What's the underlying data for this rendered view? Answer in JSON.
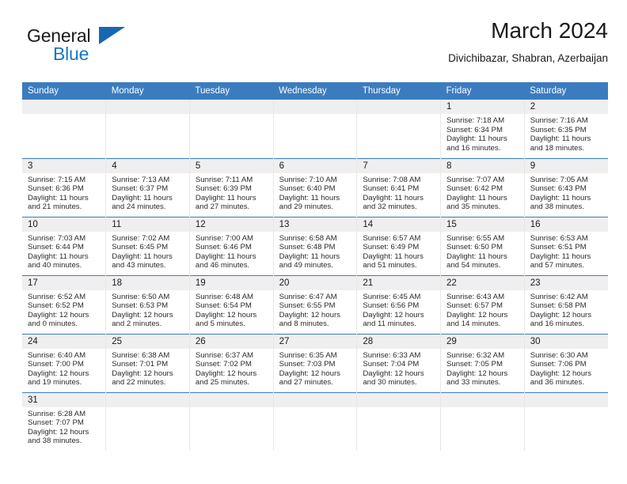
{
  "brand": {
    "line1": "General",
    "line2": "Blue",
    "flag_icon": "blue-triangle-flag"
  },
  "header": {
    "title": "March 2024",
    "subtitle": "Divichibazar, Shabran, Azerbaijan"
  },
  "colors": {
    "header_blue": "#3b7cc0",
    "brand_blue": "#1877c4",
    "daynum_band": "#efefef",
    "divider": "#e8e8e8"
  },
  "weekday_headers": [
    "Sunday",
    "Monday",
    "Tuesday",
    "Wednesday",
    "Thursday",
    "Friday",
    "Saturday"
  ],
  "labels": {
    "sunrise_prefix": "Sunrise: ",
    "sunset_prefix": "Sunset: ",
    "daylight_prefix": "Daylight: "
  },
  "weeks": [
    [
      {
        "day": "",
        "empty": true
      },
      {
        "day": "",
        "empty": true
      },
      {
        "day": "",
        "empty": true
      },
      {
        "day": "",
        "empty": true
      },
      {
        "day": "",
        "empty": true
      },
      {
        "day": "1",
        "sunrise": "Sunrise: 7:18 AM",
        "sunset": "Sunset: 6:34 PM",
        "daylight_l1": "Daylight: 11 hours",
        "daylight_l2": "and 16 minutes."
      },
      {
        "day": "2",
        "sunrise": "Sunrise: 7:16 AM",
        "sunset": "Sunset: 6:35 PM",
        "daylight_l1": "Daylight: 11 hours",
        "daylight_l2": "and 18 minutes."
      }
    ],
    [
      {
        "day": "3",
        "sunrise": "Sunrise: 7:15 AM",
        "sunset": "Sunset: 6:36 PM",
        "daylight_l1": "Daylight: 11 hours",
        "daylight_l2": "and 21 minutes."
      },
      {
        "day": "4",
        "sunrise": "Sunrise: 7:13 AM",
        "sunset": "Sunset: 6:37 PM",
        "daylight_l1": "Daylight: 11 hours",
        "daylight_l2": "and 24 minutes."
      },
      {
        "day": "5",
        "sunrise": "Sunrise: 7:11 AM",
        "sunset": "Sunset: 6:39 PM",
        "daylight_l1": "Daylight: 11 hours",
        "daylight_l2": "and 27 minutes."
      },
      {
        "day": "6",
        "sunrise": "Sunrise: 7:10 AM",
        "sunset": "Sunset: 6:40 PM",
        "daylight_l1": "Daylight: 11 hours",
        "daylight_l2": "and 29 minutes."
      },
      {
        "day": "7",
        "sunrise": "Sunrise: 7:08 AM",
        "sunset": "Sunset: 6:41 PM",
        "daylight_l1": "Daylight: 11 hours",
        "daylight_l2": "and 32 minutes."
      },
      {
        "day": "8",
        "sunrise": "Sunrise: 7:07 AM",
        "sunset": "Sunset: 6:42 PM",
        "daylight_l1": "Daylight: 11 hours",
        "daylight_l2": "and 35 minutes."
      },
      {
        "day": "9",
        "sunrise": "Sunrise: 7:05 AM",
        "sunset": "Sunset: 6:43 PM",
        "daylight_l1": "Daylight: 11 hours",
        "daylight_l2": "and 38 minutes."
      }
    ],
    [
      {
        "day": "10",
        "sunrise": "Sunrise: 7:03 AM",
        "sunset": "Sunset: 6:44 PM",
        "daylight_l1": "Daylight: 11 hours",
        "daylight_l2": "and 40 minutes."
      },
      {
        "day": "11",
        "sunrise": "Sunrise: 7:02 AM",
        "sunset": "Sunset: 6:45 PM",
        "daylight_l1": "Daylight: 11 hours",
        "daylight_l2": "and 43 minutes."
      },
      {
        "day": "12",
        "sunrise": "Sunrise: 7:00 AM",
        "sunset": "Sunset: 6:46 PM",
        "daylight_l1": "Daylight: 11 hours",
        "daylight_l2": "and 46 minutes."
      },
      {
        "day": "13",
        "sunrise": "Sunrise: 6:58 AM",
        "sunset": "Sunset: 6:48 PM",
        "daylight_l1": "Daylight: 11 hours",
        "daylight_l2": "and 49 minutes."
      },
      {
        "day": "14",
        "sunrise": "Sunrise: 6:57 AM",
        "sunset": "Sunset: 6:49 PM",
        "daylight_l1": "Daylight: 11 hours",
        "daylight_l2": "and 51 minutes."
      },
      {
        "day": "15",
        "sunrise": "Sunrise: 6:55 AM",
        "sunset": "Sunset: 6:50 PM",
        "daylight_l1": "Daylight: 11 hours",
        "daylight_l2": "and 54 minutes."
      },
      {
        "day": "16",
        "sunrise": "Sunrise: 6:53 AM",
        "sunset": "Sunset: 6:51 PM",
        "daylight_l1": "Daylight: 11 hours",
        "daylight_l2": "and 57 minutes."
      }
    ],
    [
      {
        "day": "17",
        "sunrise": "Sunrise: 6:52 AM",
        "sunset": "Sunset: 6:52 PM",
        "daylight_l1": "Daylight: 12 hours",
        "daylight_l2": "and 0 minutes."
      },
      {
        "day": "18",
        "sunrise": "Sunrise: 6:50 AM",
        "sunset": "Sunset: 6:53 PM",
        "daylight_l1": "Daylight: 12 hours",
        "daylight_l2": "and 2 minutes."
      },
      {
        "day": "19",
        "sunrise": "Sunrise: 6:48 AM",
        "sunset": "Sunset: 6:54 PM",
        "daylight_l1": "Daylight: 12 hours",
        "daylight_l2": "and 5 minutes."
      },
      {
        "day": "20",
        "sunrise": "Sunrise: 6:47 AM",
        "sunset": "Sunset: 6:55 PM",
        "daylight_l1": "Daylight: 12 hours",
        "daylight_l2": "and 8 minutes."
      },
      {
        "day": "21",
        "sunrise": "Sunrise: 6:45 AM",
        "sunset": "Sunset: 6:56 PM",
        "daylight_l1": "Daylight: 12 hours",
        "daylight_l2": "and 11 minutes."
      },
      {
        "day": "22",
        "sunrise": "Sunrise: 6:43 AM",
        "sunset": "Sunset: 6:57 PM",
        "daylight_l1": "Daylight: 12 hours",
        "daylight_l2": "and 14 minutes."
      },
      {
        "day": "23",
        "sunrise": "Sunrise: 6:42 AM",
        "sunset": "Sunset: 6:58 PM",
        "daylight_l1": "Daylight: 12 hours",
        "daylight_l2": "and 16 minutes."
      }
    ],
    [
      {
        "day": "24",
        "sunrise": "Sunrise: 6:40 AM",
        "sunset": "Sunset: 7:00 PM",
        "daylight_l1": "Daylight: 12 hours",
        "daylight_l2": "and 19 minutes."
      },
      {
        "day": "25",
        "sunrise": "Sunrise: 6:38 AM",
        "sunset": "Sunset: 7:01 PM",
        "daylight_l1": "Daylight: 12 hours",
        "daylight_l2": "and 22 minutes."
      },
      {
        "day": "26",
        "sunrise": "Sunrise: 6:37 AM",
        "sunset": "Sunset: 7:02 PM",
        "daylight_l1": "Daylight: 12 hours",
        "daylight_l2": "and 25 minutes."
      },
      {
        "day": "27",
        "sunrise": "Sunrise: 6:35 AM",
        "sunset": "Sunset: 7:03 PM",
        "daylight_l1": "Daylight: 12 hours",
        "daylight_l2": "and 27 minutes."
      },
      {
        "day": "28",
        "sunrise": "Sunrise: 6:33 AM",
        "sunset": "Sunset: 7:04 PM",
        "daylight_l1": "Daylight: 12 hours",
        "daylight_l2": "and 30 minutes."
      },
      {
        "day": "29",
        "sunrise": "Sunrise: 6:32 AM",
        "sunset": "Sunset: 7:05 PM",
        "daylight_l1": "Daylight: 12 hours",
        "daylight_l2": "and 33 minutes."
      },
      {
        "day": "30",
        "sunrise": "Sunrise: 6:30 AM",
        "sunset": "Sunset: 7:06 PM",
        "daylight_l1": "Daylight: 12 hours",
        "daylight_l2": "and 36 minutes."
      }
    ],
    [
      {
        "day": "31",
        "sunrise": "Sunrise: 6:28 AM",
        "sunset": "Sunset: 7:07 PM",
        "daylight_l1": "Daylight: 12 hours",
        "daylight_l2": "and 38 minutes."
      },
      {
        "day": "",
        "empty": true
      },
      {
        "day": "",
        "empty": true
      },
      {
        "day": "",
        "empty": true
      },
      {
        "day": "",
        "empty": true
      },
      {
        "day": "",
        "empty": true
      },
      {
        "day": "",
        "empty": true
      }
    ]
  ]
}
